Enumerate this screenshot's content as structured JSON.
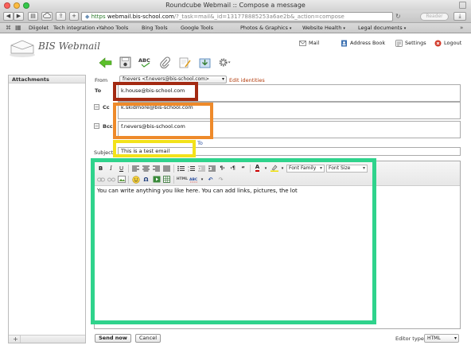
{
  "browser": {
    "window_title": "Roundcube Webmail :: Compose a message",
    "url_scheme": "https",
    "url_host": "webmail.bis-school.com",
    "url_path": "/?_task=mail&_id=131778885253a6ae2b&_action=compose",
    "reader_label": "Reader",
    "bookmarks": [
      "Diigolet",
      "Tech integration",
      "Yahoo Tools",
      "Bing Tools",
      "Google Tools",
      "Photos & Graphics",
      "Website Health",
      "Legal documents"
    ],
    "bookmark_carets": [
      false,
      true,
      false,
      false,
      false,
      true,
      true,
      true
    ]
  },
  "app": {
    "logo_text": "BIS Webmail",
    "nav": {
      "mail": "Mail",
      "address_book": "Address Book",
      "settings": "Settings",
      "logout": "Logout"
    }
  },
  "compose": {
    "attachments_title": "Attachments",
    "from_label": "From",
    "from_value": "fnevers <f.nevers@bis-school.com>",
    "edit_identities": "Edit identities",
    "to_label": "To",
    "to_value": "k.house@bis-school.com",
    "cc_label": "Cc",
    "cc_value": "k.skidmore@bis-school.com",
    "bcc_label": "Bcc",
    "bcc_value": "f.nevers@bis-school.com",
    "peek_link": "To",
    "subject_label": "Subject",
    "subject_value": "This is a test email",
    "body_text": "You can write anything you like here. You can add links, pictures, the lot",
    "font_family": "Font Family",
    "font_size": "Font Size",
    "send_button": "Send now",
    "cancel_button": "Cancel",
    "editor_type_label": "Editor type",
    "editor_type_value": "HTML"
  },
  "icons": {
    "toolbar": [
      "back-arrow-icon",
      "save-icon",
      "spellcheck-icon",
      "attach-icon",
      "signature-icon",
      "responses-icon",
      "options-gear-icon"
    ],
    "editor_row1": [
      "bold-icon",
      "italic-icon",
      "underline-icon",
      "align-left-icon",
      "align-center-icon",
      "align-right-icon",
      "align-justify-icon",
      "bullet-list-icon",
      "numbered-list-icon",
      "outdent-icon",
      "indent-icon",
      "ltr-icon",
      "rtl-icon",
      "blockquote-icon",
      "text-color-icon",
      "highlight-color-icon"
    ],
    "editor_row2": [
      "link-icon",
      "unlink-icon",
      "image-icon",
      "emoticon-icon",
      "special-char-icon",
      "media-icon",
      "table-icon",
      "html-source-icon",
      "spellcheck-icon",
      "undo-icon",
      "redo-icon"
    ]
  },
  "colors": {
    "annotation_to": "#a32a12",
    "annotation_cc_bcc": "#ee8a2a",
    "annotation_subject": "#f3e21a",
    "annotation_body": "#2fd38c",
    "link": "#b23a0a",
    "back_arrow": "#5bbf2a"
  }
}
